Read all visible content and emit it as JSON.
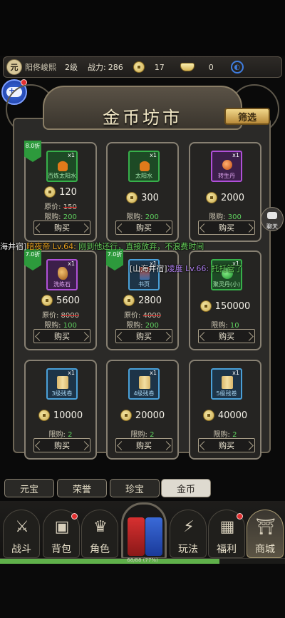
{
  "status_bar": {
    "avatar_char": "元",
    "player_name": "阳佟峻熙",
    "level": "2级",
    "power_label": "战力:",
    "power_value": "286",
    "coins": "17",
    "ingots": "0"
  },
  "shop": {
    "title": "金币坊市",
    "filter_label": "筛选"
  },
  "items": [
    {
      "name": "百炼太阳水",
      "qty": "x1",
      "price": "120",
      "orig_label": "原价:",
      "orig_price": "150",
      "limit_label": "限购:",
      "limit": "200",
      "discount": "8.0折",
      "buy": "购买",
      "color": "green"
    },
    {
      "name": "太阳水",
      "qty": "x1",
      "price": "300",
      "limit_label": "限购:",
      "limit": "200",
      "buy": "购买",
      "color": "green"
    },
    {
      "name": "转生丹",
      "qty": "x1",
      "price": "2000",
      "limit_label": "限购:",
      "limit": "300",
      "buy": "购买",
      "color": "purple"
    },
    {
      "name": "洗练石",
      "qty": "x1",
      "price": "5600",
      "orig_label": "原价:",
      "orig_price": "8000",
      "limit_label": "限购:",
      "limit": "100",
      "discount": "7.0折",
      "buy": "购买",
      "color": "purple"
    },
    {
      "name": "书页",
      "qty": "x1",
      "price": "2800",
      "orig_label": "原价:",
      "orig_price": "4000",
      "limit_label": "限购:",
      "limit": "200",
      "discount": "7.0折",
      "buy": "购买",
      "color": "blue"
    },
    {
      "name": "聚灵丹(小)",
      "qty": "x1",
      "price": "150000",
      "limit_label": "限购:",
      "limit": "10",
      "buy": "购买",
      "color": "green"
    },
    {
      "name": "3级残卷",
      "qty": "x1",
      "price": "10000",
      "limit_label": "限购:",
      "limit": "2",
      "buy": "购买",
      "color": "blue"
    },
    {
      "name": "4级残卷",
      "qty": "x1",
      "price": "20000",
      "limit_label": "限购:",
      "limit": "2",
      "buy": "购买",
      "color": "blue"
    },
    {
      "name": "5级残卷",
      "qty": "x1",
      "price": "40000",
      "limit_label": "限购:",
      "limit": "2",
      "buy": "购买",
      "color": "blue"
    }
  ],
  "chat": {
    "line1_prefix": "海井宿]",
    "line1_name": "暗夜帝 Lv.64:",
    "line1_msg": "刚到他还行，直接放弃，不浪费时间",
    "line2_prefix": "[山海井宿]",
    "line2_name": "凌度 Lv.66:",
    "line2_msg": "托托管了",
    "chat_button": "聊天"
  },
  "tabs": [
    "元宝",
    "荣誉",
    "珍宝",
    "金币"
  ],
  "nav": [
    "战斗",
    "背包",
    "角色",
    "玩法",
    "福利",
    "商城"
  ],
  "xp_text": "68/88 (77%)",
  "xp_fraction": 0.77,
  "colors": {
    "discount_green": "#2d9a3c",
    "limit_green": "#5ed05e",
    "strike_red": "#e02020",
    "chat_orange": "#e6a01e",
    "chat_green": "#66d05a",
    "chat_purple": "#b080f0"
  }
}
